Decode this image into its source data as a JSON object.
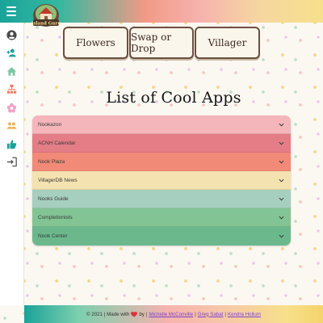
{
  "header": {
    "logo_text": "Island Guru",
    "colors": {
      "teal": "#1aa39a",
      "coral": "#f29a86",
      "yellow": "#f7e08b"
    }
  },
  "sidebar": {
    "items": [
      {
        "icon": "user-circle-icon",
        "color": "#4a4a4a"
      },
      {
        "icon": "add-user-icon",
        "color": "#1aa39a"
      },
      {
        "icon": "home-icon",
        "color": "#7cc6a6"
      },
      {
        "icon": "sitemap-icon",
        "color": "#f07c66"
      },
      {
        "icon": "flower-icon",
        "color": "#f2a3c8"
      },
      {
        "icon": "people-icon",
        "color": "#f0b24b"
      },
      {
        "icon": "thumbs-up-icon",
        "color": "#1aa39a"
      },
      {
        "icon": "sign-in-icon",
        "color": "#555555"
      }
    ]
  },
  "nav": {
    "buttons": [
      "Flowers",
      "Swap or Drop",
      "Villager"
    ]
  },
  "main": {
    "title": "List of Cool Apps",
    "apps": [
      {
        "label": "Nookazon",
        "color": "#f4b5bb"
      },
      {
        "label": "ACNH Calendar",
        "color": "#e57d86"
      },
      {
        "label": "Nook Plaza",
        "color": "#f28a78"
      },
      {
        "label": "VillagerDB News",
        "color": "#f4e2b0"
      },
      {
        "label": "Nooks Guide",
        "color": "#a6cfbf"
      },
      {
        "label": "Completionists",
        "color": "#82c493"
      },
      {
        "label": "Nook Center",
        "color": "#6bb88d"
      }
    ]
  },
  "footer": {
    "copyright": "© 2021 | Made with",
    "by": "by",
    "authors": [
      "Michelle McConville",
      "Greg Sabat",
      "Kendra Hollum"
    ]
  }
}
